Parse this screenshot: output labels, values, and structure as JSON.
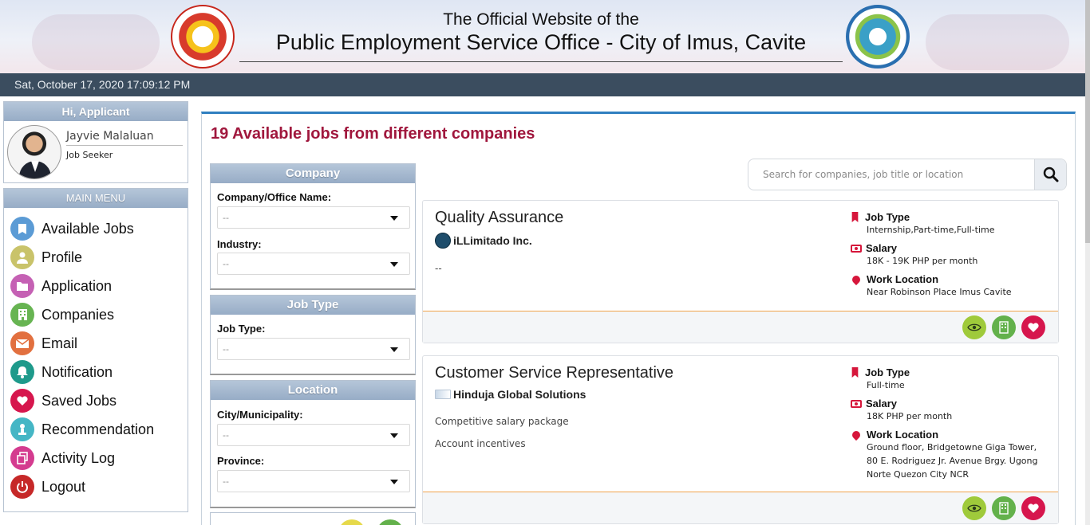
{
  "header": {
    "line1": "The Official Website of the",
    "line2": "Public Employment Service Office - City of Imus, Cavite",
    "left_seal": "peso-seal",
    "right_seal": "imus-city-seal"
  },
  "datebar": {
    "datetime": "Sat, October 17, 2020 17:09:12 PM"
  },
  "user": {
    "greeting": "Hi, Applicant",
    "name": "Jayvie Malaluan",
    "role": "Job Seeker"
  },
  "menu": {
    "title": "MAIN MENU",
    "items": [
      {
        "label": "Available Jobs",
        "icon": "bookmark-icon",
        "color": "#5b9bd5"
      },
      {
        "label": "Profile",
        "icon": "user-icon",
        "color": "#c9c36a"
      },
      {
        "label": "Application",
        "icon": "folder-icon",
        "color": "#c561b4"
      },
      {
        "label": "Companies",
        "icon": "building-icon",
        "color": "#67b452"
      },
      {
        "label": "Email",
        "icon": "envelope-icon",
        "color": "#e2703f"
      },
      {
        "label": "Notification",
        "icon": "bell-icon",
        "color": "#1e9a8b"
      },
      {
        "label": "Saved Jobs",
        "icon": "heart-icon",
        "color": "#d6164d"
      },
      {
        "label": "Recommendation",
        "icon": "recommend-icon",
        "color": "#45b6c5"
      },
      {
        "label": "Activity Log",
        "icon": "copy-icon",
        "color": "#d43b8f"
      },
      {
        "label": "Logout",
        "icon": "power-icon",
        "color": "#c62828"
      }
    ]
  },
  "main": {
    "title": "19 Available jobs from different companies",
    "search_placeholder": "Search for companies, job title or location"
  },
  "filters": {
    "company": {
      "title": "Company",
      "name_label": "Company/Office Name:",
      "name_value": "--",
      "industry_label": "Industry:",
      "industry_value": "--"
    },
    "jobtype": {
      "title": "Job Type",
      "label": "Job Type:",
      "value": "--"
    },
    "location": {
      "title": "Location",
      "city_label": "City/Municipality:",
      "city_value": "--",
      "province_label": "Province:",
      "province_value": "--"
    }
  },
  "meta_labels": {
    "job_type": "Job Type",
    "salary": "Salary",
    "work_location": "Work Location"
  },
  "jobs": [
    {
      "title": "Quality Assurance",
      "company": "iLLimitado Inc.",
      "desc1": "--",
      "desc2": "",
      "job_type": "Internship,Part-time,Full-time",
      "salary": "18K - 19K PHP per month",
      "location": "Near Robinson Place Imus Cavite"
    },
    {
      "title": "Customer Service Representative",
      "company": "Hinduja Global Solutions",
      "desc1": "Competitive salary package",
      "desc2": "Account incentives",
      "job_type": "Full-time",
      "salary": "18K PHP per month",
      "location": "Ground floor, Bridgetowne Giga Tower, 80 E. Rodriguez Jr. Avenue Brgy. Ugong Norte Quezon City NCR"
    }
  ]
}
